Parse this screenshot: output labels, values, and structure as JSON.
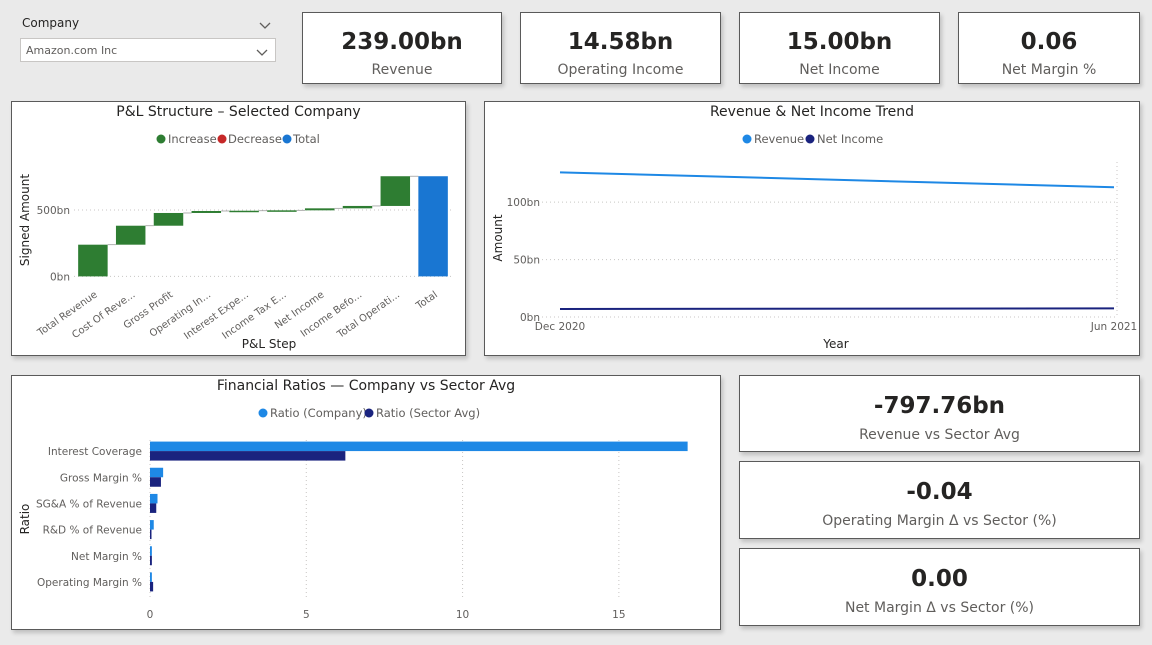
{
  "slicer": {
    "label": "Company",
    "value": "Amazon.com Inc"
  },
  "cards": [
    {
      "value": "239.00bn",
      "label": "Revenue"
    },
    {
      "value": "14.58bn",
      "label": "Operating Income"
    },
    {
      "value": "15.00bn",
      "label": "Net Income"
    },
    {
      "value": "0.06",
      "label": "Net Margin %"
    }
  ],
  "side_cards": [
    {
      "value": "-797.76bn",
      "label": "Revenue vs Sector Avg"
    },
    {
      "value": "-0.04",
      "label": "Operating Margin Δ vs Sector (%)"
    },
    {
      "value": "0.00",
      "label": "Net Margin Δ vs Sector (%)"
    }
  ],
  "colors": {
    "increase": "#2e7d32",
    "decrease": "#c62828",
    "total": "#1976d2",
    "revenue": "#1e88e5",
    "net_income": "#1a237e",
    "company": "#1e88e5",
    "sector": "#1a237e"
  },
  "chart_data": [
    {
      "type": "waterfall",
      "title": "P&L Structure – Selected Company",
      "legend": [
        "Increase",
        "Decrease",
        "Total"
      ],
      "xlabel": "P&L Step",
      "ylabel": "Signed Amount",
      "categories": [
        "Total Revenue",
        "Cost Of Reve...",
        "Gross Profit",
        "Operating In...",
        "Interest Expe...",
        "Income Tax E...",
        "Net Income",
        "Income Befo...",
        "Total Operati...",
        "Total"
      ],
      "values": [
        239,
        143,
        96,
        15,
        2,
        3,
        15,
        18,
        224,
        755
      ],
      "kinds": [
        "increase",
        "increase",
        "increase",
        "increase",
        "increase",
        "increase",
        "increase",
        "increase",
        "increase",
        "total"
      ],
      "y_ticks": [
        {
          "value": 0,
          "label": "0bn"
        },
        {
          "value": 500,
          "label": "500bn"
        }
      ],
      "ylim": [
        -80,
        900
      ]
    },
    {
      "type": "line",
      "title": "Revenue & Net Income Trend",
      "xlabel": "Year",
      "ylabel": "Amount",
      "x": [
        "Dec 2020",
        "Jun 2021"
      ],
      "series": [
        {
          "name": "Revenue",
          "values": [
            126,
            113
          ]
        },
        {
          "name": "Net Income",
          "values": [
            7,
            7.5
          ]
        }
      ],
      "y_ticks": [
        {
          "value": 0,
          "label": "0bn"
        },
        {
          "value": 50,
          "label": "50bn"
        },
        {
          "value": 100,
          "label": "100bn"
        }
      ],
      "ylim": [
        0,
        135
      ]
    },
    {
      "type": "bar",
      "orientation": "horizontal",
      "title": "Financial Ratios — Company vs Sector Avg",
      "ylabel": "Ratio",
      "categories": [
        "Interest Coverage",
        "Gross Margin %",
        "SG&A % of Revenue",
        "R&D % of Revenue",
        "Net Margin %",
        "Operating Margin %"
      ],
      "series": [
        {
          "name": "Ratio (Company)",
          "values": [
            17.2,
            0.42,
            0.24,
            0.12,
            0.06,
            0.06
          ]
        },
        {
          "name": "Ratio (Sector Avg)",
          "values": [
            6.25,
            0.35,
            0.2,
            0.02,
            0.06,
            0.1
          ]
        }
      ],
      "x_ticks": [
        0,
        5,
        10,
        15
      ],
      "xlim": [
        0,
        17.5
      ]
    }
  ]
}
